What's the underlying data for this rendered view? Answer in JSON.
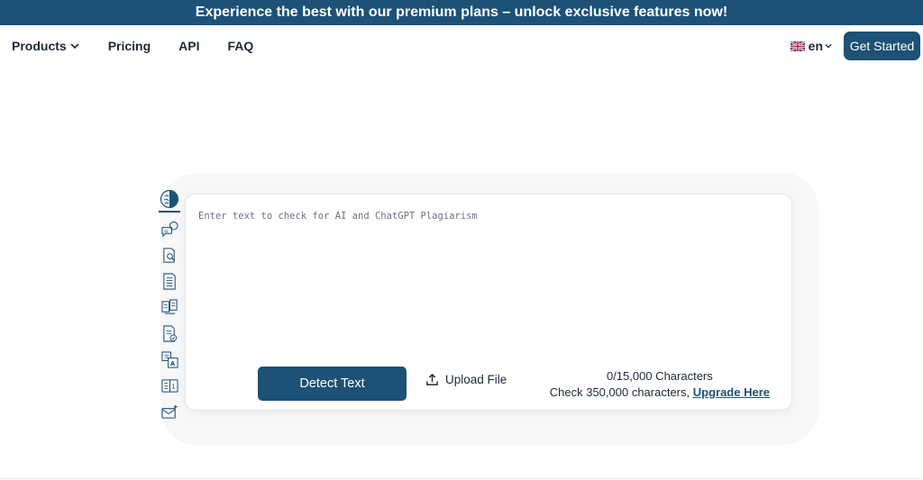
{
  "promo": {
    "text": "Experience the best with our premium plans – unlock exclusive features now!"
  },
  "nav": {
    "links": [
      "Products",
      "Pricing",
      "API",
      "FAQ"
    ],
    "language": "en",
    "cta": "Get Started"
  },
  "tools": [
    {
      "icon": "brain-icon",
      "active": true
    },
    {
      "icon": "ai-chat-icon"
    },
    {
      "icon": "document-search-icon"
    },
    {
      "icon": "document-list-icon"
    },
    {
      "icon": "document-compare-icon"
    },
    {
      "icon": "document-check-icon"
    },
    {
      "icon": "translate-icon"
    },
    {
      "icon": "grammar-check-icon"
    },
    {
      "icon": "email-sparkle-icon"
    }
  ],
  "editor": {
    "placeholder": "Enter text to check for AI and ChatGPT Plagiarism",
    "value": "",
    "detect_label": "Detect Text",
    "upload_label": "Upload File",
    "char_count": "0/15,000 Characters",
    "upgrade_prefix": "Check 350,000 characters,",
    "upgrade_link": "Upgrade Here"
  },
  "colors": {
    "brand": "#1d5175"
  }
}
